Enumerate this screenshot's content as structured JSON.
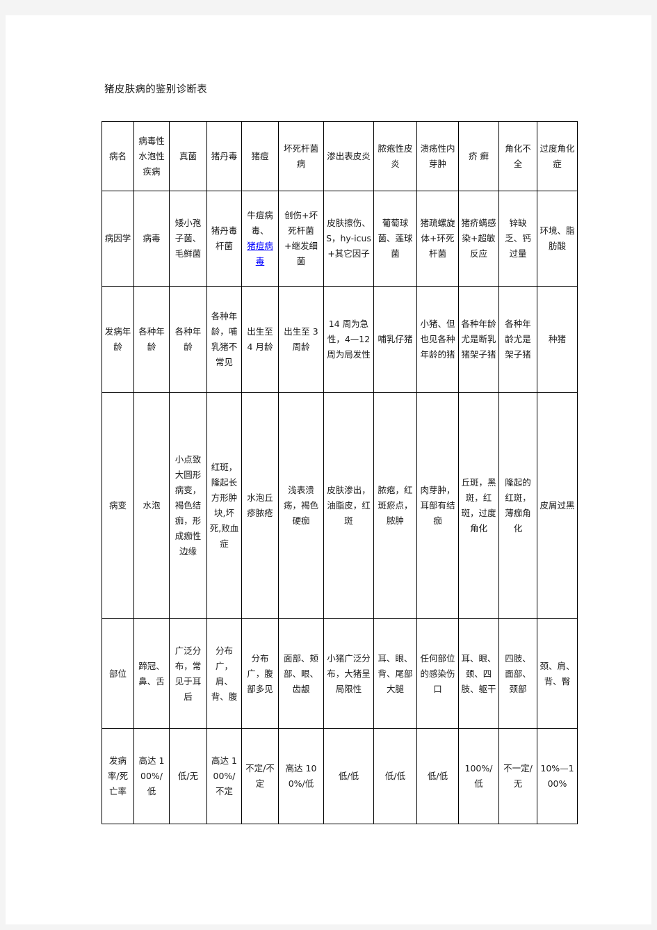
{
  "document": {
    "title": "猪皮肤病的鉴别诊断表"
  },
  "table": {
    "headers": [
      "病名",
      "病毒性水泡性疾病",
      "真菌",
      "猪丹毒",
      "猪痘",
      "坏死杆菌病",
      "渗出表皮炎",
      "脓疱性皮炎",
      "溃疡性内芽肿",
      "疥 癣",
      "角化不全",
      "过度角化症"
    ],
    "rows": [
      {
        "label": "病因学",
        "cells": [
          "病毒",
          "矮小孢子菌、毛鲜菌",
          "猪丹毒杆菌",
          "牛痘病毒、",
          "创伤+坏死杆菌+继发细菌",
          "皮肤擦伤、S，hy-icus+其它因子",
          "葡萄球菌、莲球菌",
          "猪疏螺旋体+环死杆菌",
          "猪疥螨感染+超敏反应",
          "锌缺乏、钙过量",
          "环境、脂肪酸"
        ],
        "link_cell_index": 3,
        "link_text": "猪痘病毒"
      },
      {
        "label": "发病年龄",
        "cells": [
          "各种年龄",
          "各种年龄",
          "各种年龄，哺乳猪不常见",
          "出生至 4 月龄",
          "出生至 3 周龄",
          "14 周为急性，4—12 周为局发性",
          "哺乳仔猪",
          "小猪、但也见各种年龄的猪",
          "各种年龄尤是断乳猪架子猪",
          "各种年龄尤是架子猪",
          "种猪"
        ]
      },
      {
        "label": "病变",
        "cells": [
          "水泡",
          "小点致大圆形病变，褐色结痂，形成痂性边缘",
          "红斑，隆起长方形肿块,坏死,败血症",
          "水泡丘疹脓疮",
          "浅表溃疡，褐色硬痂",
          "皮肤渗出，油脂皮，红斑",
          "脓疱，红斑瘀点，脓肿",
          "肉芽肿，耳部有结痂",
          "丘斑，黑斑，红斑，过度角化",
          "隆起的红斑，薄痂角化",
          "皮屑过黑"
        ]
      },
      {
        "label": "部位",
        "cells": [
          "蹄冠、鼻、舌",
          "广泛分布，常见于耳后",
          "分布广，肩、背、腹",
          "分布广，腹部多见",
          "面部、颊部、眼、齿龈",
          "小猪广泛分布，大猪呈局限性",
          "耳、眼、背、尾部大腿",
          "任何部位的感染伤口",
          "耳、眼、颈、四肢、躯干",
          "四肢、面部、颈部",
          "颈、肩、背、臀"
        ]
      },
      {
        "label": "发病率/死亡率",
        "cells": [
          "高达 100%/低",
          "低/无",
          "高达 100%/不定",
          "不定/不定",
          "高达 100%/低",
          "低/低",
          "低/低",
          "低/低",
          "100%/低",
          "不一定/无",
          "10%—100%"
        ]
      }
    ]
  },
  "colors": {
    "link": "#0000ff",
    "border": "#000000",
    "page_background": "#ffffff",
    "canvas_background": "#f4f4f4"
  }
}
